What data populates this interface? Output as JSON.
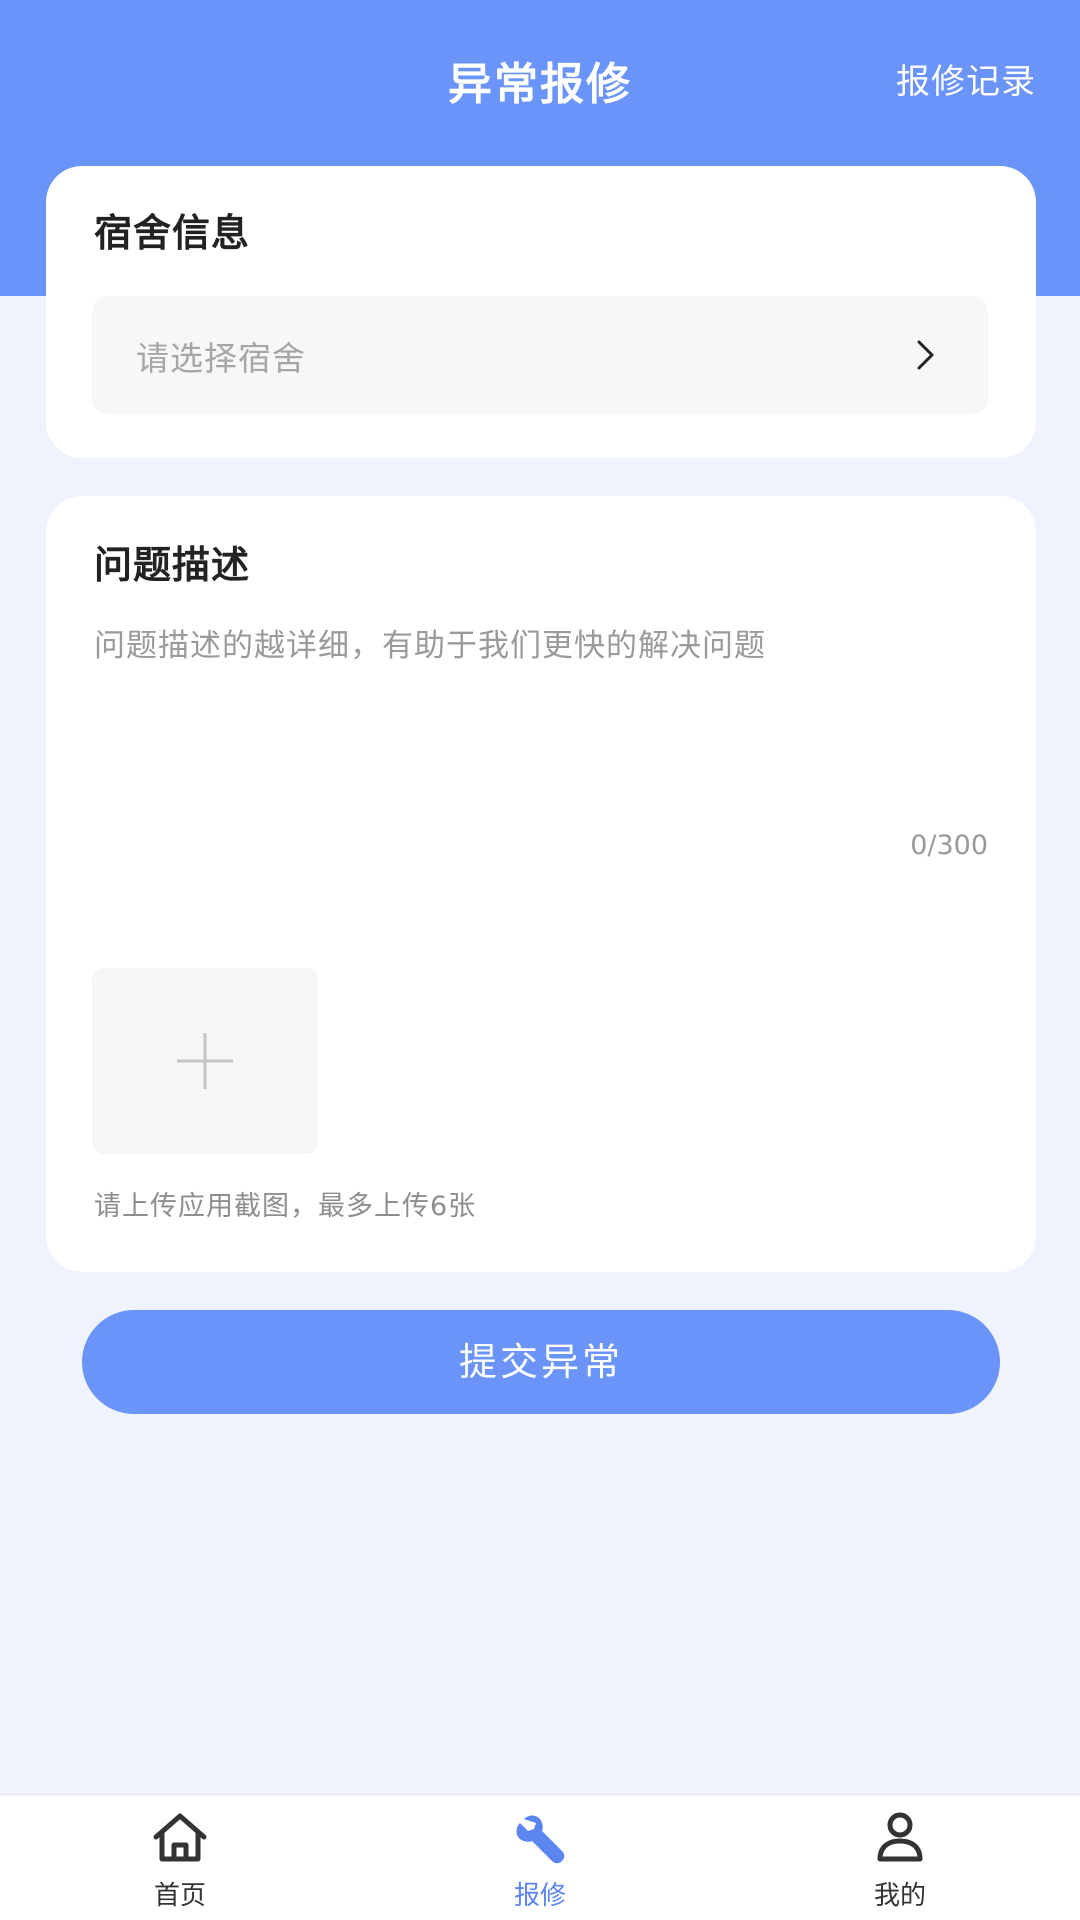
{
  "header": {
    "title": "异常报修",
    "action_label": "报修记录"
  },
  "dorm_card": {
    "title": "宿舍信息",
    "select_placeholder": "请选择宿舍"
  },
  "problem_card": {
    "title": "问题描述",
    "description_placeholder": "问题描述的越详细，有助于我们更快的解决问题",
    "char_count": "0/300",
    "upload_hint": "请上传应用截图，最多上传6张"
  },
  "submit_label": "提交异常",
  "tabbar": {
    "items": [
      {
        "label": "首页",
        "icon": "home-icon",
        "active": false
      },
      {
        "label": "报修",
        "icon": "wrench-icon",
        "active": true
      },
      {
        "label": "我的",
        "icon": "user-icon",
        "active": false
      }
    ]
  },
  "colors": {
    "primary": "#6B94F8",
    "page_background": "#EEF3FE",
    "active_tab": "#5B86F0"
  }
}
